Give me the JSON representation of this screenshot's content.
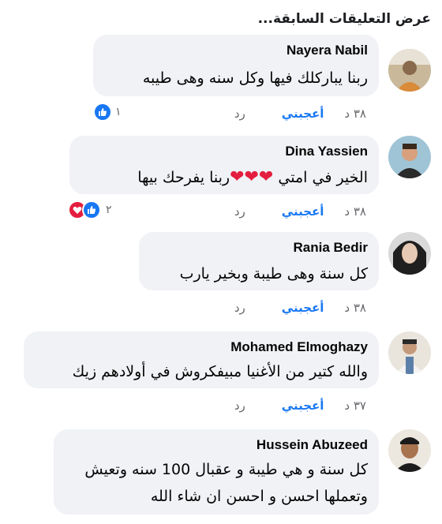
{
  "view_previous": "عرض التعليقات السابقة...",
  "comments": [
    {
      "author": "Nayera Nabil",
      "lines": [
        "ربنا يباركلك فيها وكل سنه وهى طيبه"
      ],
      "time": "٣٨ د",
      "like": "أعجبني",
      "reply": "رد",
      "reaction_count": "١",
      "reactions": [
        "like"
      ]
    },
    {
      "author": "Dina Yassien",
      "lines": [
        "الخير في امتي"
      ],
      "line_suffix": "ربنا يفرحك بيها",
      "hearts": "❤❤❤",
      "time": "٣٨ د",
      "like": "أعجبني",
      "reply": "رد",
      "reaction_count": "٢",
      "reactions": [
        "like",
        "love"
      ]
    },
    {
      "author": "Rania Bedir",
      "lines": [
        "كل سنة وهى طيبة وبخير يارب"
      ],
      "time": "٣٨ د",
      "like": "أعجبني",
      "reply": "رد"
    },
    {
      "author": "Mohamed Elmoghazy",
      "lines": [
        "والله كتير من الأغنيا مبيفكروش في أولادهم زيك"
      ],
      "time": "٣٧ د",
      "like": "أعجبني",
      "reply": "رد"
    },
    {
      "author": "Hussein Abuzeed",
      "lines": [
        "كل سنة و هي طيبة و عقبال 100 سنه وتعيش",
        "وتعملها احسن و احسن ان شاء الله"
      ],
      "time": "",
      "like": "",
      "reply": ""
    }
  ],
  "colors": {
    "bubble": "#f0f2f5",
    "link": "#1877f2",
    "muted": "#65676b",
    "heart": "#e41e3f"
  }
}
